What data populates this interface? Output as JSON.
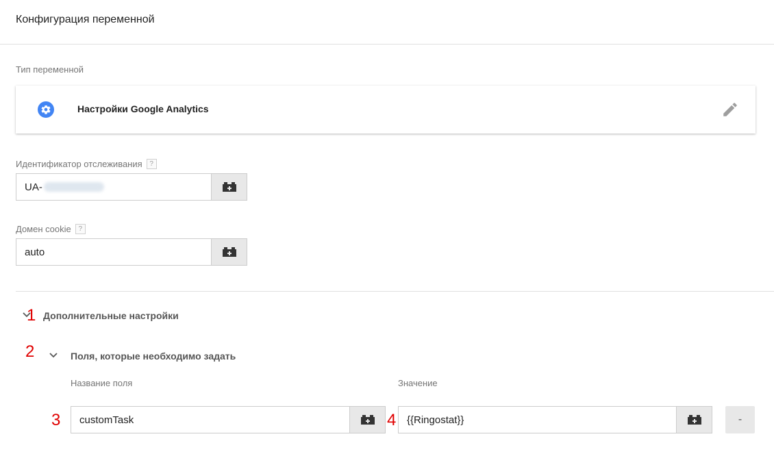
{
  "page": {
    "title": "Конфигурация переменной"
  },
  "variable_type": {
    "label": "Тип переменной",
    "name": "Настройки Google Analytics",
    "icon": "gear-icon",
    "edit_icon": "pencil-icon",
    "icon_color": "#4285f4"
  },
  "tracking_id": {
    "label": "Идентификатор отслеживания",
    "help": "?",
    "value": "UA-"
  },
  "cookie_domain": {
    "label": "Домен cookie",
    "help": "?",
    "value": "auto"
  },
  "advanced": {
    "label": "Дополнительные настройки",
    "fields_to_set": {
      "label": "Поля, которые необходимо задать",
      "col_name": "Название поля",
      "col_value": "Значение",
      "rows": [
        {
          "name": "customTask",
          "value": "{{Ringostat}}",
          "remove_label": "-"
        }
      ]
    }
  },
  "annotations": [
    "1",
    "2",
    "3",
    "4"
  ],
  "annotation_color": "#e00000"
}
